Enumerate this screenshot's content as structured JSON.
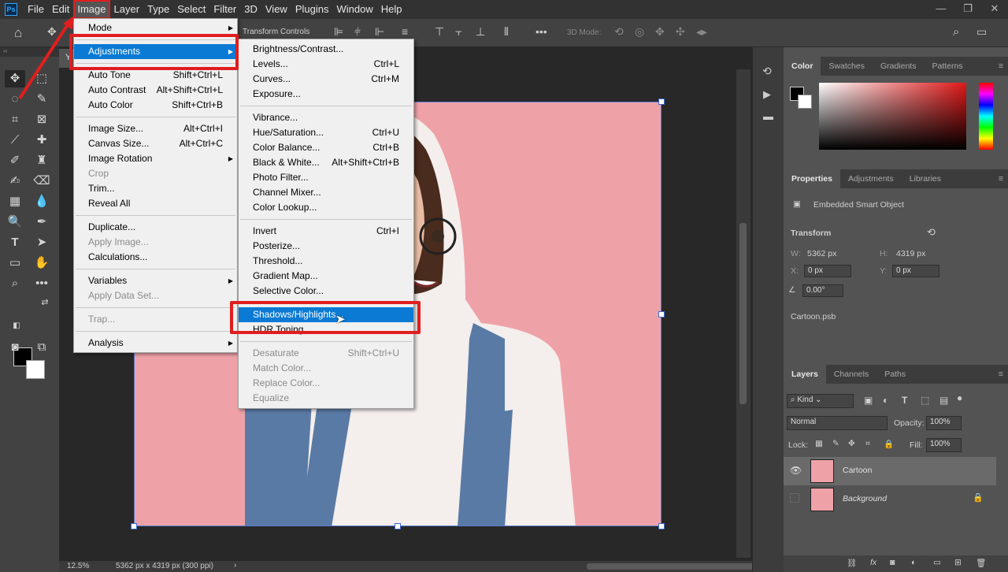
{
  "menubar": {
    "logo": "Ps",
    "items": [
      "File",
      "Edit",
      "Image",
      "Layer",
      "Type",
      "Select",
      "Filter",
      "3D",
      "View",
      "Plugins",
      "Window",
      "Help"
    ],
    "active": "Image"
  },
  "window_controls": {
    "minimize": "—",
    "restore": "❐",
    "close": "✕"
  },
  "options_bar": {
    "transform_controls": "Transform Controls",
    "mode_3d": "3D Mode:"
  },
  "document": {
    "tab_title": "Y"
  },
  "status": {
    "zoom": "12.5%",
    "doc_info": "5362 px x 4319 px (300 ppi)"
  },
  "image_menu": {
    "items": [
      {
        "label": "Mode",
        "shortcut": "",
        "submenu": true,
        "disabled": false
      },
      {
        "sep": true
      },
      {
        "label": "Adjustments",
        "shortcut": "",
        "submenu": true,
        "disabled": false,
        "highlight": true
      },
      {
        "sep": true
      },
      {
        "label": "Auto Tone",
        "shortcut": "Shift+Ctrl+L",
        "disabled": false
      },
      {
        "label": "Auto Contrast",
        "shortcut": "Alt+Shift+Ctrl+L",
        "disabled": false
      },
      {
        "label": "Auto Color",
        "shortcut": "Shift+Ctrl+B",
        "disabled": false
      },
      {
        "sep": true
      },
      {
        "label": "Image Size...",
        "shortcut": "Alt+Ctrl+I",
        "disabled": false
      },
      {
        "label": "Canvas Size...",
        "shortcut": "Alt+Ctrl+C",
        "disabled": false
      },
      {
        "label": "Image Rotation",
        "shortcut": "",
        "submenu": true,
        "disabled": false
      },
      {
        "label": "Crop",
        "shortcut": "",
        "disabled": true
      },
      {
        "label": "Trim...",
        "shortcut": "",
        "disabled": false
      },
      {
        "label": "Reveal All",
        "shortcut": "",
        "disabled": false
      },
      {
        "sep": true
      },
      {
        "label": "Duplicate...",
        "shortcut": "",
        "disabled": false
      },
      {
        "label": "Apply Image...",
        "shortcut": "",
        "disabled": true
      },
      {
        "label": "Calculations...",
        "shortcut": "",
        "disabled": false
      },
      {
        "sep": true
      },
      {
        "label": "Variables",
        "shortcut": "",
        "submenu": true,
        "disabled": false
      },
      {
        "label": "Apply Data Set...",
        "shortcut": "",
        "disabled": true
      },
      {
        "sep": true
      },
      {
        "label": "Trap...",
        "shortcut": "",
        "disabled": true
      },
      {
        "sep": true
      },
      {
        "label": "Analysis",
        "shortcut": "",
        "submenu": true,
        "disabled": false
      }
    ]
  },
  "adjustments_menu": {
    "items": [
      {
        "label": "Brightness/Contrast...",
        "shortcut": "",
        "disabled": false
      },
      {
        "label": "Levels...",
        "shortcut": "Ctrl+L",
        "disabled": false
      },
      {
        "label": "Curves...",
        "shortcut": "Ctrl+M",
        "disabled": false
      },
      {
        "label": "Exposure...",
        "shortcut": "",
        "disabled": false
      },
      {
        "sep": true
      },
      {
        "label": "Vibrance...",
        "shortcut": "",
        "disabled": false
      },
      {
        "label": "Hue/Saturation...",
        "shortcut": "Ctrl+U",
        "disabled": false
      },
      {
        "label": "Color Balance...",
        "shortcut": "Ctrl+B",
        "disabled": false
      },
      {
        "label": "Black & White...",
        "shortcut": "Alt+Shift+Ctrl+B",
        "disabled": false
      },
      {
        "label": "Photo Filter...",
        "shortcut": "",
        "disabled": false
      },
      {
        "label": "Channel Mixer...",
        "shortcut": "",
        "disabled": false
      },
      {
        "label": "Color Lookup...",
        "shortcut": "",
        "disabled": false
      },
      {
        "sep": true
      },
      {
        "label": "Invert",
        "shortcut": "Ctrl+I",
        "disabled": false
      },
      {
        "label": "Posterize...",
        "shortcut": "",
        "disabled": false
      },
      {
        "label": "Threshold...",
        "shortcut": "",
        "disabled": false
      },
      {
        "label": "Gradient Map...",
        "shortcut": "",
        "disabled": false
      },
      {
        "label": "Selective Color...",
        "shortcut": "",
        "disabled": false
      },
      {
        "sep": true
      },
      {
        "label": "Shadows/Highlights...",
        "shortcut": "",
        "disabled": false,
        "highlight": true
      },
      {
        "label": "HDR Toning...",
        "shortcut": "",
        "disabled": false
      },
      {
        "sep": true
      },
      {
        "label": "Desaturate",
        "shortcut": "Shift+Ctrl+U",
        "disabled": true
      },
      {
        "label": "Match Color...",
        "shortcut": "",
        "disabled": true
      },
      {
        "label": "Replace Color...",
        "shortcut": "",
        "disabled": true
      },
      {
        "label": "Equalize",
        "shortcut": "",
        "disabled": true
      }
    ]
  },
  "color_panel": {
    "tabs": [
      "Color",
      "Swatches",
      "Gradients",
      "Patterns"
    ],
    "active": "Color"
  },
  "properties_panel": {
    "tabs": [
      "Properties",
      "Adjustments",
      "Libraries"
    ],
    "active": "Properties",
    "object_type": "Embedded Smart Object",
    "section": "Transform",
    "w_label": "W:",
    "w": "5362 px",
    "h_label": "H:",
    "h": "4319 px",
    "x_label": "X:",
    "x": "0 px",
    "y_label": "Y:",
    "y": "0 px",
    "angle": "0.00°",
    "filename": "Cartoon.psb"
  },
  "layers_panel": {
    "tabs": [
      "Layers",
      "Channels",
      "Paths"
    ],
    "active": "Layers",
    "filter": "Kind",
    "blend_mode": "Normal",
    "opacity_label": "Opacity:",
    "opacity": "100%",
    "lock_label": "Lock:",
    "fill_label": "Fill:",
    "fill": "100%",
    "layers": [
      {
        "name": "Cartoon",
        "selected": true
      },
      {
        "name": "Background",
        "selected": false
      }
    ]
  },
  "colors": {
    "accent": "#0a7ad4",
    "annotation": "#e01e1e",
    "canvas_bg": "#eea2a8"
  }
}
